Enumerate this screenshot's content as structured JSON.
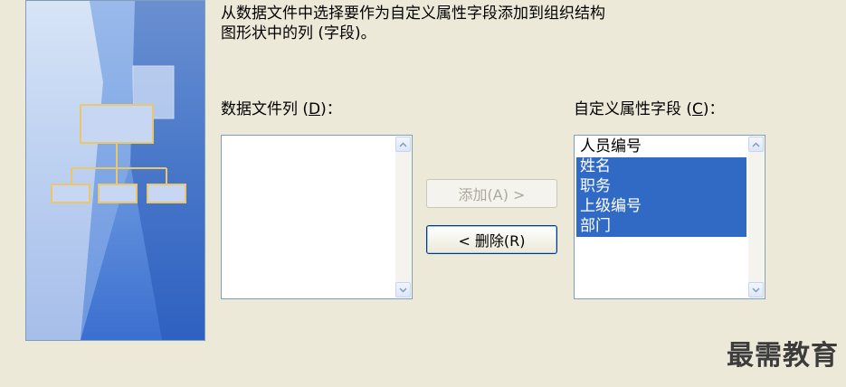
{
  "instruction": {
    "line1": "从数据文件中选择要作为自定义属性字段添加到组织结构",
    "line2": "图形状中的列 (字段)。"
  },
  "data_file_columns": {
    "label_prefix": "数据文件列 (",
    "label_key": "D",
    "label_suffix": ")：",
    "items": []
  },
  "custom_fields": {
    "label_prefix": "自定义属性字段 (",
    "label_key": "C",
    "label_suffix": ")：",
    "items": [
      {
        "label": "人员编号",
        "selected": false
      },
      {
        "label": "姓名",
        "selected": true
      },
      {
        "label": "职务",
        "selected": true
      },
      {
        "label": "上级编号",
        "selected": true
      },
      {
        "label": "部门",
        "selected": true
      }
    ]
  },
  "buttons": {
    "add_label": "添加(A) >",
    "delete_label": "< 删除(R)",
    "add_enabled": false
  },
  "watermark": "最需教育",
  "colors": {
    "dialog_bg": "#ece9d8",
    "selection": "#316ac5",
    "border": "#7f9db9"
  }
}
